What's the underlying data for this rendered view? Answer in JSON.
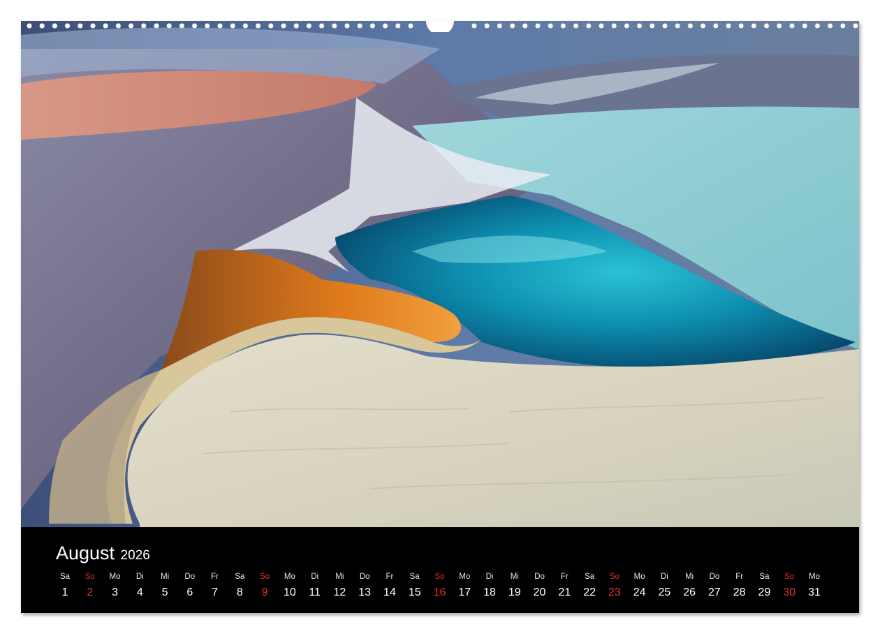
{
  "calendar": {
    "month": "August",
    "year": "2026",
    "sunday_color": "#e0322b",
    "days": [
      {
        "wd": "Sa",
        "d": "1"
      },
      {
        "wd": "So",
        "d": "2",
        "sun": true
      },
      {
        "wd": "Mo",
        "d": "3"
      },
      {
        "wd": "Di",
        "d": "4"
      },
      {
        "wd": "Mi",
        "d": "5"
      },
      {
        "wd": "Do",
        "d": "6"
      },
      {
        "wd": "Fr",
        "d": "7"
      },
      {
        "wd": "Sa",
        "d": "8"
      },
      {
        "wd": "So",
        "d": "9",
        "sun": true
      },
      {
        "wd": "Mo",
        "d": "10"
      },
      {
        "wd": "Di",
        "d": "11"
      },
      {
        "wd": "Mi",
        "d": "12"
      },
      {
        "wd": "Do",
        "d": "13"
      },
      {
        "wd": "Fr",
        "d": "14"
      },
      {
        "wd": "Sa",
        "d": "15"
      },
      {
        "wd": "So",
        "d": "16",
        "sun": true
      },
      {
        "wd": "Mo",
        "d": "17"
      },
      {
        "wd": "Di",
        "d": "18"
      },
      {
        "wd": "Mi",
        "d": "19"
      },
      {
        "wd": "Do",
        "d": "20"
      },
      {
        "wd": "Fr",
        "d": "21"
      },
      {
        "wd": "Sa",
        "d": "22"
      },
      {
        "wd": "So",
        "d": "23",
        "sun": true
      },
      {
        "wd": "Mo",
        "d": "24"
      },
      {
        "wd": "Di",
        "d": "25"
      },
      {
        "wd": "Mi",
        "d": "26"
      },
      {
        "wd": "Do",
        "d": "27"
      },
      {
        "wd": "Fr",
        "d": "28"
      },
      {
        "wd": "Sa",
        "d": "29"
      },
      {
        "wd": "So",
        "d": "30",
        "sun": true
      },
      {
        "wd": "Mo",
        "d": "31"
      }
    ]
  }
}
